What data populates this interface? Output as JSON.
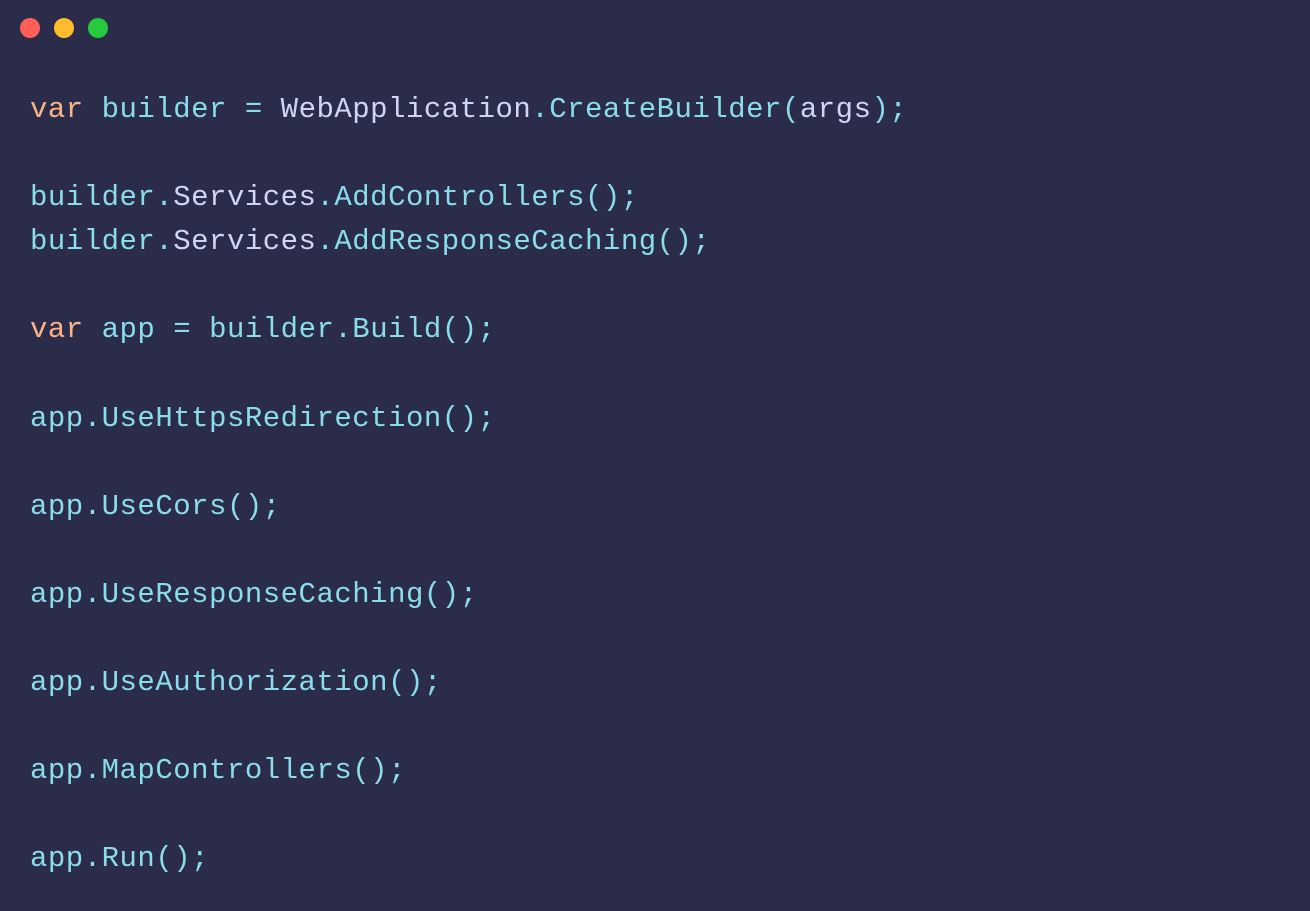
{
  "code": {
    "lines": [
      {
        "tokens": [
          {
            "type": "keyword",
            "text": "var"
          },
          {
            "type": "space",
            "text": " "
          },
          {
            "type": "var-name",
            "text": "builder"
          },
          {
            "type": "space",
            "text": " "
          },
          {
            "type": "operator",
            "text": "="
          },
          {
            "type": "space",
            "text": " "
          },
          {
            "type": "type",
            "text": "WebApplication"
          },
          {
            "type": "dot",
            "text": "."
          },
          {
            "type": "method",
            "text": "CreateBuilder"
          },
          {
            "type": "paren",
            "text": "("
          },
          {
            "type": "param",
            "text": "args"
          },
          {
            "type": "paren",
            "text": ")"
          },
          {
            "type": "semi",
            "text": ";"
          }
        ]
      },
      {
        "tokens": []
      },
      {
        "tokens": [
          {
            "type": "var-name",
            "text": "builder"
          },
          {
            "type": "dot",
            "text": "."
          },
          {
            "type": "identifier",
            "text": "Services"
          },
          {
            "type": "dot",
            "text": "."
          },
          {
            "type": "method",
            "text": "AddControllers"
          },
          {
            "type": "paren",
            "text": "()"
          },
          {
            "type": "semi",
            "text": ";"
          }
        ]
      },
      {
        "tokens": [
          {
            "type": "var-name",
            "text": "builder"
          },
          {
            "type": "dot",
            "text": "."
          },
          {
            "type": "identifier",
            "text": "Services"
          },
          {
            "type": "dot",
            "text": "."
          },
          {
            "type": "method",
            "text": "AddResponseCaching"
          },
          {
            "type": "paren",
            "text": "()"
          },
          {
            "type": "semi",
            "text": ";"
          }
        ]
      },
      {
        "tokens": []
      },
      {
        "tokens": [
          {
            "type": "keyword",
            "text": "var"
          },
          {
            "type": "space",
            "text": " "
          },
          {
            "type": "var-name",
            "text": "app"
          },
          {
            "type": "space",
            "text": " "
          },
          {
            "type": "operator",
            "text": "="
          },
          {
            "type": "space",
            "text": " "
          },
          {
            "type": "var-name",
            "text": "builder"
          },
          {
            "type": "dot",
            "text": "."
          },
          {
            "type": "method",
            "text": "Build"
          },
          {
            "type": "paren",
            "text": "()"
          },
          {
            "type": "semi",
            "text": ";"
          }
        ]
      },
      {
        "tokens": []
      },
      {
        "tokens": [
          {
            "type": "var-name",
            "text": "app"
          },
          {
            "type": "dot",
            "text": "."
          },
          {
            "type": "method",
            "text": "UseHttpsRedirection"
          },
          {
            "type": "paren",
            "text": "()"
          },
          {
            "type": "semi",
            "text": ";"
          }
        ]
      },
      {
        "tokens": []
      },
      {
        "tokens": [
          {
            "type": "var-name",
            "text": "app"
          },
          {
            "type": "dot",
            "text": "."
          },
          {
            "type": "method",
            "text": "UseCors"
          },
          {
            "type": "paren",
            "text": "()"
          },
          {
            "type": "semi",
            "text": ";"
          }
        ]
      },
      {
        "tokens": []
      },
      {
        "tokens": [
          {
            "type": "var-name",
            "text": "app"
          },
          {
            "type": "dot",
            "text": "."
          },
          {
            "type": "method",
            "text": "UseResponseCaching"
          },
          {
            "type": "paren",
            "text": "()"
          },
          {
            "type": "semi",
            "text": ";"
          }
        ]
      },
      {
        "tokens": []
      },
      {
        "tokens": [
          {
            "type": "var-name",
            "text": "app"
          },
          {
            "type": "dot",
            "text": "."
          },
          {
            "type": "method",
            "text": "UseAuthorization"
          },
          {
            "type": "paren",
            "text": "()"
          },
          {
            "type": "semi",
            "text": ";"
          }
        ]
      },
      {
        "tokens": []
      },
      {
        "tokens": [
          {
            "type": "var-name",
            "text": "app"
          },
          {
            "type": "dot",
            "text": "."
          },
          {
            "type": "method",
            "text": "MapControllers"
          },
          {
            "type": "paren",
            "text": "()"
          },
          {
            "type": "semi",
            "text": ";"
          }
        ]
      },
      {
        "tokens": []
      },
      {
        "tokens": [
          {
            "type": "var-name",
            "text": "app"
          },
          {
            "type": "dot",
            "text": "."
          },
          {
            "type": "method",
            "text": "Run"
          },
          {
            "type": "paren",
            "text": "()"
          },
          {
            "type": "semi",
            "text": ";"
          }
        ]
      }
    ]
  }
}
